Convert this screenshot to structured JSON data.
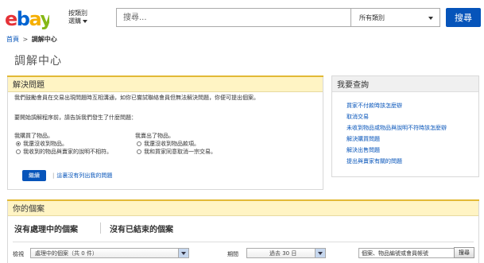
{
  "header": {
    "logo_letters": [
      "e",
      "b",
      "a",
      "y"
    ],
    "category_line1": "按類別",
    "category_line2": "選購",
    "search_placeholder": "搜尋...",
    "category_select": "所有類別",
    "search_button": "搜尋"
  },
  "breadcrumb": {
    "home": "首頁",
    "separator": ">",
    "current": "調解中心"
  },
  "page_title": "調解中心",
  "resolve": {
    "title": "解決問題",
    "intro": "我們鼓勵會員在交易出現問題時互相溝通，如你已嘗試聯絡會員但無法解決問題，你便可提出個案。",
    "prompt": "要開始調解程序前，請告訴我們發生了什麼問題：",
    "buyer_heading": "我購買了物品。",
    "buyer_options": [
      {
        "label": "我還沒收到物品。",
        "selected": true
      },
      {
        "label": "我收到的物品與賣家的說明不相符。",
        "selected": false
      }
    ],
    "seller_heading": "我賣出了物品。",
    "seller_options": [
      {
        "label": "我還沒收到物品款項。",
        "selected": false
      },
      {
        "label": "我和買家同意取消一宗交易。",
        "selected": false
      }
    ],
    "continue_button": "繼續",
    "not_listed_link": "這裏沒有列出我的問題"
  },
  "query": {
    "title": "我要查詢",
    "links": [
      "買家不付款時該怎麼辦",
      "取消交易",
      "未收到物品或物品與說明不符時該怎麼辦",
      "解決購買問題",
      "解決出售問題",
      "提出與賣家有關的問題"
    ]
  },
  "cases": {
    "title": "你的個案",
    "tab_open": "沒有處理中的個案",
    "tab_closed": "沒有已結束的個案",
    "view_label": "檢視",
    "view_value": "處理中的個案（共 0 件）",
    "period_label": "期間",
    "period_value": "過去 30 日",
    "search_value": "個案、物品編號或會員帳號",
    "search_button": "搜尋"
  },
  "colors": {
    "ebay_red": "#e53238",
    "ebay_blue": "#0064d2",
    "ebay_yellow": "#f5af02",
    "ebay_green": "#86b817",
    "primary_button": "#0654ba",
    "panel_header": "#fff4c4",
    "link": "#0654ba"
  },
  "icons": {
    "category_caret": "chevron-down-icon",
    "select_caret": "chevron-down-icon"
  }
}
